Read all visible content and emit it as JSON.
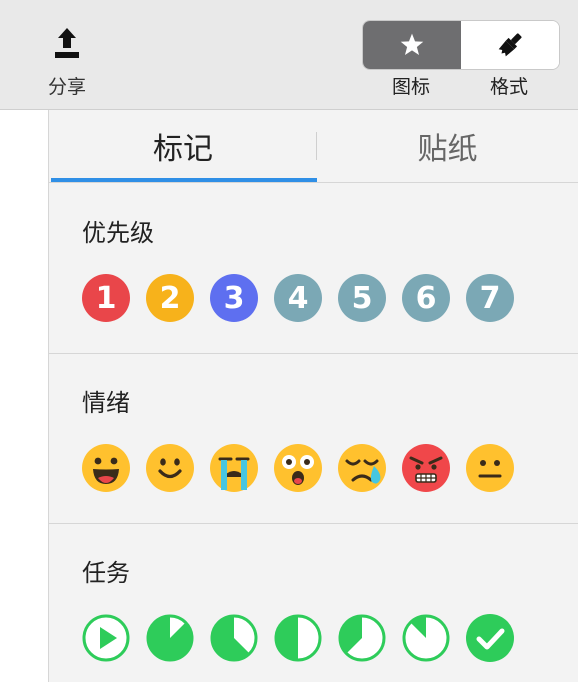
{
  "toolbar": {
    "share_label": "分享",
    "segmented": {
      "left_label": "图标",
      "right_label": "格式",
      "left_icon": "star-icon",
      "right_icon": "brush-icon",
      "selected": "图标"
    }
  },
  "tabs": [
    {
      "label": "标记",
      "active": true
    },
    {
      "label": "贴纸",
      "active": false
    }
  ],
  "sections": {
    "priority": {
      "title": "优先级",
      "items": [
        {
          "label": "1",
          "color": "#e9464a"
        },
        {
          "label": "2",
          "color": "#f7b21b"
        },
        {
          "label": "3",
          "color": "#5e6ff0"
        },
        {
          "label": "4",
          "color": "#7ba8b5"
        },
        {
          "label": "5",
          "color": "#7ba8b5"
        },
        {
          "label": "6",
          "color": "#7ba8b5"
        },
        {
          "label": "7",
          "color": "#7ba8b5"
        }
      ]
    },
    "emotion": {
      "title": "情绪",
      "items": [
        "laughing-face-icon",
        "smiling-face-icon",
        "crying-face-icon",
        "surprised-face-icon",
        "sleepy-face-icon",
        "angry-face-icon",
        "neutral-face-icon"
      ]
    },
    "task": {
      "title": "任务",
      "items": [
        {
          "icon": "task-start-icon",
          "progress": 0
        },
        {
          "icon": "task-progress-icon",
          "progress": 0.125
        },
        {
          "icon": "task-progress-icon",
          "progress": 0.375
        },
        {
          "icon": "task-progress-icon",
          "progress": 0.5
        },
        {
          "icon": "task-progress-icon",
          "progress": 0.625
        },
        {
          "icon": "task-progress-icon",
          "progress": 0.875
        },
        {
          "icon": "task-done-icon",
          "progress": 1
        }
      ]
    }
  },
  "colors": {
    "accent": "#2f8fe6",
    "task_green": "#2ecc5a",
    "emoji_yellow": "#ffc12e",
    "emoji_red": "#f0474a"
  }
}
